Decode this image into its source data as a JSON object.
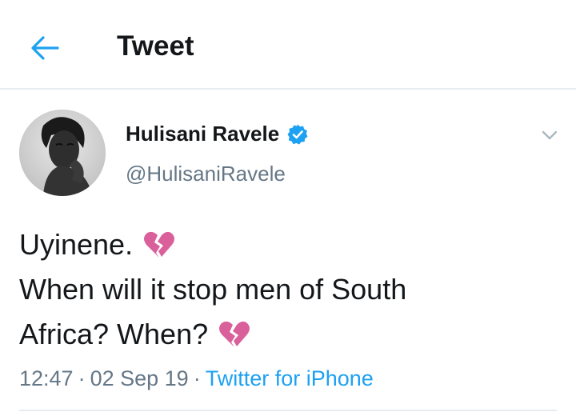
{
  "header": {
    "title": "Tweet",
    "back_icon": "arrow-left-icon"
  },
  "tweet": {
    "author": {
      "display_name": "Hulisani Ravele",
      "handle": "@HulisaniRavele",
      "verified": true,
      "avatar": "profile-photo"
    },
    "text_lines": [
      "Uyinene.",
      "When will it stop men of South",
      "Africa? When?"
    ],
    "emoji": "broken-heart",
    "time": "12:47",
    "date": "02 Sep 19",
    "source": "Twitter for iPhone",
    "separator": "·"
  },
  "colors": {
    "accent": "#1da1f2",
    "text": "#14171a",
    "secondary": "#657786",
    "border": "#e6ecf0",
    "emoji": "#d9609a"
  }
}
